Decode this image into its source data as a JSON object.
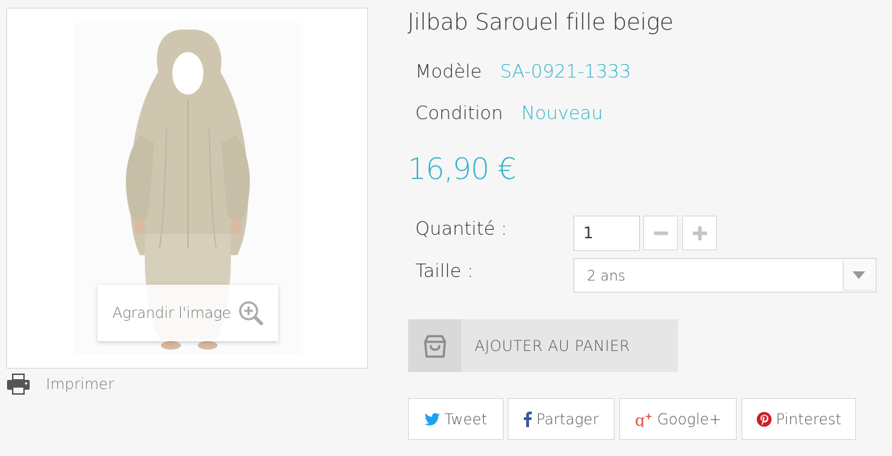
{
  "product": {
    "title": "Jilbab Sarouel fille beige",
    "model_label": "Modèle",
    "model_value": "SA-0921-1333",
    "condition_label": "Condition",
    "condition_value": "Nouveau",
    "price": "16,90 €"
  },
  "image": {
    "zoom_label": "Agrandir l'image",
    "zoom_icon": "magnifier-plus-icon"
  },
  "print": {
    "label": "Imprimer",
    "icon": "printer-icon"
  },
  "form": {
    "quantity_label": "Quantité :",
    "quantity_value": "1",
    "size_label": "Taille :",
    "size_selected": "2 ans"
  },
  "cart": {
    "label": "AJOUTER AU PANIER",
    "icon": "shopping-bag-icon"
  },
  "share": {
    "tweet": "Tweet",
    "partager": "Partager",
    "google": "Google+",
    "pinterest": "Pinterest"
  },
  "colors": {
    "accent": "#2fb5c9",
    "twitter": "#1da1f2",
    "facebook": "#3b5998",
    "google": "#dd4b39",
    "pinterest": "#cb2027"
  }
}
